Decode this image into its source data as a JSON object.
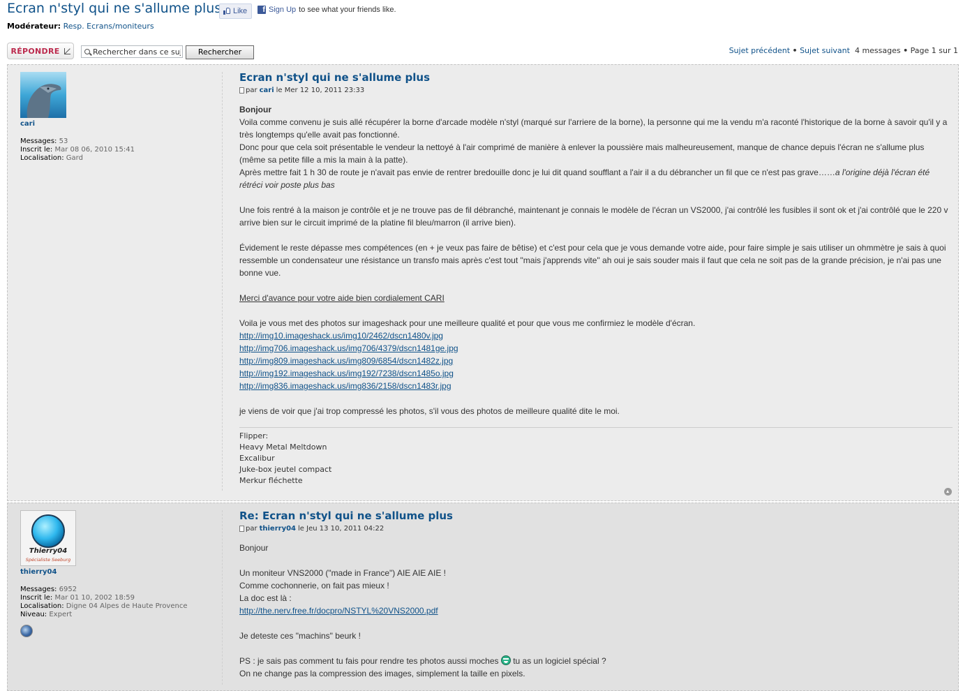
{
  "header": {
    "title": "Ecran n'styl qui ne s'allume plus",
    "like_label": "Like",
    "fb_signup_link": "Sign Up",
    "fb_signup_text": "to see what your friends like.",
    "moderator_label": "Modérateur:",
    "moderator_link": "Resp. Ecrans/moniteurs"
  },
  "actions": {
    "reply_label": "RÉPONDRE",
    "search_placeholder": "Rechercher dans ce sujet…",
    "search_button": "Rechercher",
    "prev_topic": "Sujet précédent",
    "next_topic": "Sujet suivant",
    "bullet": "•",
    "messages_count": "4 messages",
    "page_info": "Page 1 sur 1"
  },
  "posts": [
    {
      "username": "cari",
      "stats": [
        {
          "label": "Messages:",
          "value": "53"
        },
        {
          "label": "Inscrit le:",
          "value": "Mar 08 06, 2010 15:41"
        },
        {
          "label": "Localisation:",
          "value": "Gard"
        }
      ],
      "title": "Ecran n'styl qui ne s'allume plus",
      "by": "par",
      "author": "cari",
      "date": "le Mer 12 10, 2011 23:33",
      "p1_bold": "Bonjour",
      "p1_a": "Voila comme convenu je suis allé récupérer la borne d'arcade modèle n'styl (marqué sur l'arriere de la borne), la personne qui me la vendu m'a raconté l'historique de la borne à savoir qu'il y a très longtemps qu'elle avait pas fonctionné.",
      "p1_b": "Donc pour que cela soit présentable le vendeur la nettoyé à l'air comprimé de manière à enlever la poussière mais malheureusement, manque de chance depuis l'écran ne s'allume plus (même sa petite fille a mis la main à la patte).",
      "p1_c": "Après mettre fait 1 h 30 de route je n'avait pas envie de rentrer bredouille donc je lui dit quand soufflant a l'air il a du débrancher un fil que ce n'est pas grave……",
      "p1_c_italic": "a l'origine déjà l'écran été rétréci voir poste plus bas",
      "p2": "Une fois rentré à la maison je contrôle et je ne trouve pas de fil débranché, maintenant je connais le modèle de l'écran un VS2000, j'ai contrôlé les fusibles il sont ok et j'ai contrôlé que le 220 v arrive bien sur le circuit imprimé de la platine fil bleu/marron (il arrive bien).",
      "p3": "Évidement le reste dépasse mes compétences (en + je veux pas faire de bêtise) et c'est pour cela que je vous demande votre aide, pour faire simple je sais utiliser un ohmmètre je sais à quoi ressemble un condensateur une résistance un transfo mais après c'est tout \"mais j'apprends vite\" ah oui je sais souder mais il faut que cela ne soit pas de la grande précision, je n'ai pas une bonne vue.",
      "p4": "Merci d'avance pour votre aide bien cordialement CARI",
      "p5": "Voila je vous met des photos sur imageshack pour une meilleure qualité et pour que vous me confirmiez le modèle d'écran.",
      "links": [
        "http://img10.imageshack.us/img10/2462/dscn1480v.jpg",
        "http://img706.imageshack.us/img706/4379/dscn1481ge.jpg",
        "http://img809.imageshack.us/img809/6854/dscn1482z.jpg",
        "http://img192.imageshack.us/img192/7238/dscn1485o.jpg",
        "http://img836.imageshack.us/img836/2158/dscn1483r.jpg"
      ],
      "p6": "je viens de voir que j'ai trop compressé les photos, s'il vous des photos de meilleure qualité dite le moi.",
      "signature": [
        "Flipper:",
        "Heavy Metal Meltdown",
        "Excalibur",
        "Juke-box jeutel compact",
        "Merkur fléchette"
      ]
    },
    {
      "username": "thierry04",
      "avatar_name": "Thierry04",
      "avatar_sub": "Spécialiste Seeburg",
      "stats": [
        {
          "label": "Messages:",
          "value": "6952"
        },
        {
          "label": "Inscrit le:",
          "value": "Mar 01 10, 2002 18:59"
        },
        {
          "label": "Localisation:",
          "value": "Digne 04 Alpes de Haute Provence"
        },
        {
          "label": "Niveau:",
          "value": "Expert"
        }
      ],
      "title": "Re: Ecran n'styl qui ne s'allume plus",
      "by": "par",
      "author": "thierry04",
      "date": "le Jeu 13 10, 2011 04:22",
      "l1": "Bonjour",
      "l2": "Un moniteur VNS2000 (\"made in France\") AIE AIE AIE !",
      "l3": "Comme cochonnerie, on fait pas mieux !",
      "l4": "La doc est là :",
      "link": "http://the.nerv.free.fr/docpro/NSTYL%20VNS2000.pdf",
      "l5": "Je deteste ces \"machins\" beurk !",
      "l6a": "PS : je sais pas comment tu fais pour rendre tes photos aussi moches",
      "l6b": "tu as un logiciel spécial ?",
      "l7": "On ne change pas la compression des images, simplement la taille en pixels."
    }
  ]
}
